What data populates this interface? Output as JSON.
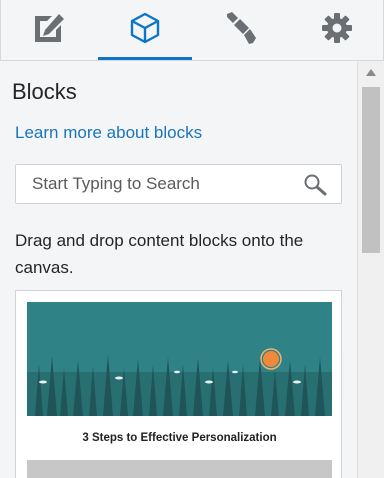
{
  "tabs": [
    {
      "name": "edit",
      "icon": "pencil-edit-icon",
      "active": false
    },
    {
      "name": "blocks",
      "icon": "cube-icon",
      "active": true
    },
    {
      "name": "style",
      "icon": "paintbrush-icon",
      "active": false
    },
    {
      "name": "settings",
      "icon": "gear-icon",
      "active": false
    }
  ],
  "panel": {
    "title": "Blocks",
    "learn_link": "Learn more about blocks",
    "search_placeholder": "Start Typing to Search",
    "help_text": "Drag and drop content blocks onto the canvas."
  },
  "block_card": {
    "title": "3 Steps to Effective Personalization",
    "image": "forest-sunset-illustration"
  },
  "colors": {
    "accent": "#0d74c7",
    "link": "#1a76b9",
    "icon_gray": "#6b6f73",
    "banner_teal": "#2f8387",
    "sun": "#f0893a"
  }
}
